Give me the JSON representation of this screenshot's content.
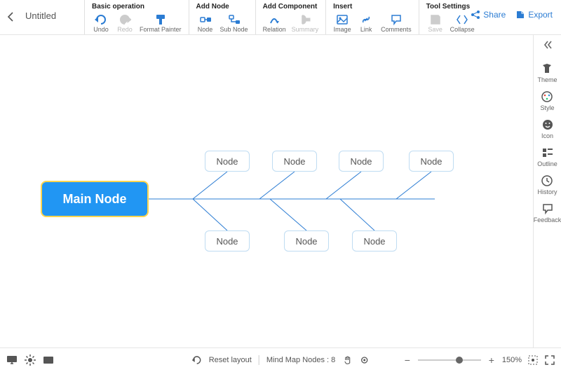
{
  "doc": {
    "title": "Untitled"
  },
  "actions": {
    "share": "Share",
    "export": "Export"
  },
  "toolbar": {
    "groups": [
      {
        "title": "Basic operation",
        "items": [
          "Undo",
          "Redo",
          "Format Painter"
        ]
      },
      {
        "title": "Add Node",
        "items": [
          "Node",
          "Sub Node"
        ]
      },
      {
        "title": "Add Component",
        "items": [
          "Relation",
          "Summary"
        ]
      },
      {
        "title": "Insert",
        "items": [
          "Image",
          "Link",
          "Comments"
        ]
      },
      {
        "title": "Tool Settings",
        "items": [
          "Save",
          "Collapse"
        ]
      }
    ]
  },
  "sidepanel": {
    "items": [
      {
        "label": "Theme"
      },
      {
        "label": "Style"
      },
      {
        "label": "Icon"
      },
      {
        "label": "Outline"
      },
      {
        "label": "History"
      },
      {
        "label": "Feedback"
      }
    ]
  },
  "mindmap": {
    "main": "Main Node",
    "children": [
      "Node",
      "Node",
      "Node",
      "Node",
      "Node",
      "Node",
      "Node"
    ]
  },
  "statusbar": {
    "reset": "Reset layout",
    "nodes_label": "Mind Map Nodes :",
    "nodes_count": "8",
    "zoom_pct": "150%"
  }
}
